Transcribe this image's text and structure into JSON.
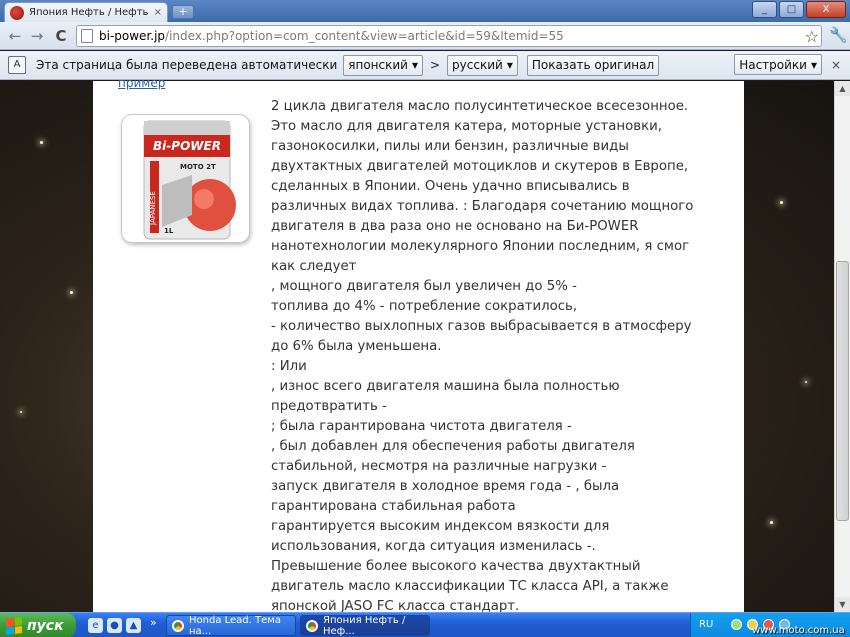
{
  "tab": {
    "title": "Япония Нефть / Нефть Япон",
    "close": "×"
  },
  "new_tab": "+",
  "window_buttons": {
    "minimize": "_",
    "maximize": "□",
    "close": "X"
  },
  "nav": {
    "back": "←",
    "forward": "→",
    "reload": "C"
  },
  "address": {
    "domain": "bi-power.jp",
    "path": "/index.php?option=com_content&view=article&id=59&Itemid=55",
    "star": "☆"
  },
  "wrench": "🔧",
  "translate_bar": {
    "icon": "A",
    "message": "Эта страница была переведена автоматически",
    "source_lang": "японский",
    "arrow": ">",
    "target_lang": "русский",
    "show_original": "Показать оригинал",
    "settings": "Настройки",
    "dropdown_marker": "▾",
    "close": "×"
  },
  "article": {
    "example_link": "пример",
    "product_image": {
      "brand": "Bi-POWER",
      "line": "MOTO 2T",
      "side_text": "JAPANESE",
      "volume": "1L"
    },
    "lines": [
      "2 цикла двигателя масло полусинтетическое всесезонное.",
      "Это масло для двигателя катера, моторные установки,",
      "газонокосилки, пилы или бензин, различные виды",
      "двухтактных двигателей мотоциклов и скутеров в Европе,",
      "сделанных в Японии. Очень удачно вписывались в",
      "различных видах топлива. : Благодаря сочетанию мощного",
      "двигателя в два раза оно не основано на Би-POWER",
      "нанотехнологии молекулярного Японии последним, я смог",
      "как следует",
      ", мощного двигателя был увеличен до 5% -",
      "топлива до 4% - потребление сократилось,",
      "- количество выхлопных газов выбрасывается в атмосферу",
      "до 6% была уменьшена.",
      ": Или",
      ", износ всего двигателя машина была полностью",
      "предотвратить -",
      "; была гарантирована чистота двигателя -",
      ", был добавлен для обеспечения работы двигателя",
      "стабильной, несмотря на различные нагрузки -",
      "запуск двигателя в холодное время года - , была",
      "гарантирована стабильная работа",
      "гарантируется высоким индексом вязкости для",
      "использования, когда ситуация изменилась -.",
      "Превышение более высокого качества двухтактный",
      "двигатель масло классификации ТС класса API, а также",
      "японской JASO FC класса стандарт."
    ]
  },
  "scrollbar": {
    "up": "▲",
    "down": "▼"
  },
  "taskbar": {
    "start": "пуск",
    "quicklaunch_more": "»",
    "tasks": [
      "Honda Lead. Тема на...",
      "Япония Нефть / Неф..."
    ],
    "lang": "RU",
    "watermark": "www.moto.com.ua"
  }
}
